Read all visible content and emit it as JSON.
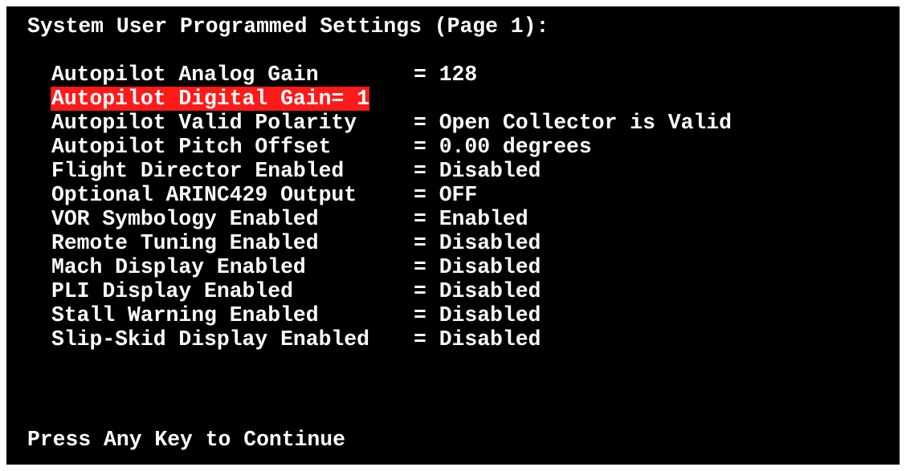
{
  "screen": {
    "title": "System User Programmed Settings (Page 1):",
    "footer": "Press Any Key to Continue",
    "selected_color": "#ff1a1a",
    "settings": [
      {
        "label": "Autopilot Analog Gain",
        "value": "128"
      },
      {
        "label": "Autopilot Digital Gain",
        "value": "1",
        "selected": true
      },
      {
        "label": "Autopilot Valid Polarity",
        "value": "Open Collector is Valid"
      },
      {
        "label": "Autopilot Pitch Offset",
        "value": "0.00 degrees"
      },
      {
        "label": "Flight Director Enabled",
        "value": "Disabled"
      },
      {
        "label": "Optional ARINC429 Output",
        "value": "OFF"
      },
      {
        "label": "VOR Symbology Enabled",
        "value": "Enabled"
      },
      {
        "label": "Remote Tuning Enabled",
        "value": "Disabled"
      },
      {
        "label": "Mach Display Enabled",
        "value": "Disabled"
      },
      {
        "label": "PLI Display Enabled",
        "value": "Disabled"
      },
      {
        "label": "Stall Warning Enabled",
        "value": "Disabled"
      },
      {
        "label": "Slip-Skid Display Enabled",
        "value": "Disabled"
      }
    ]
  }
}
